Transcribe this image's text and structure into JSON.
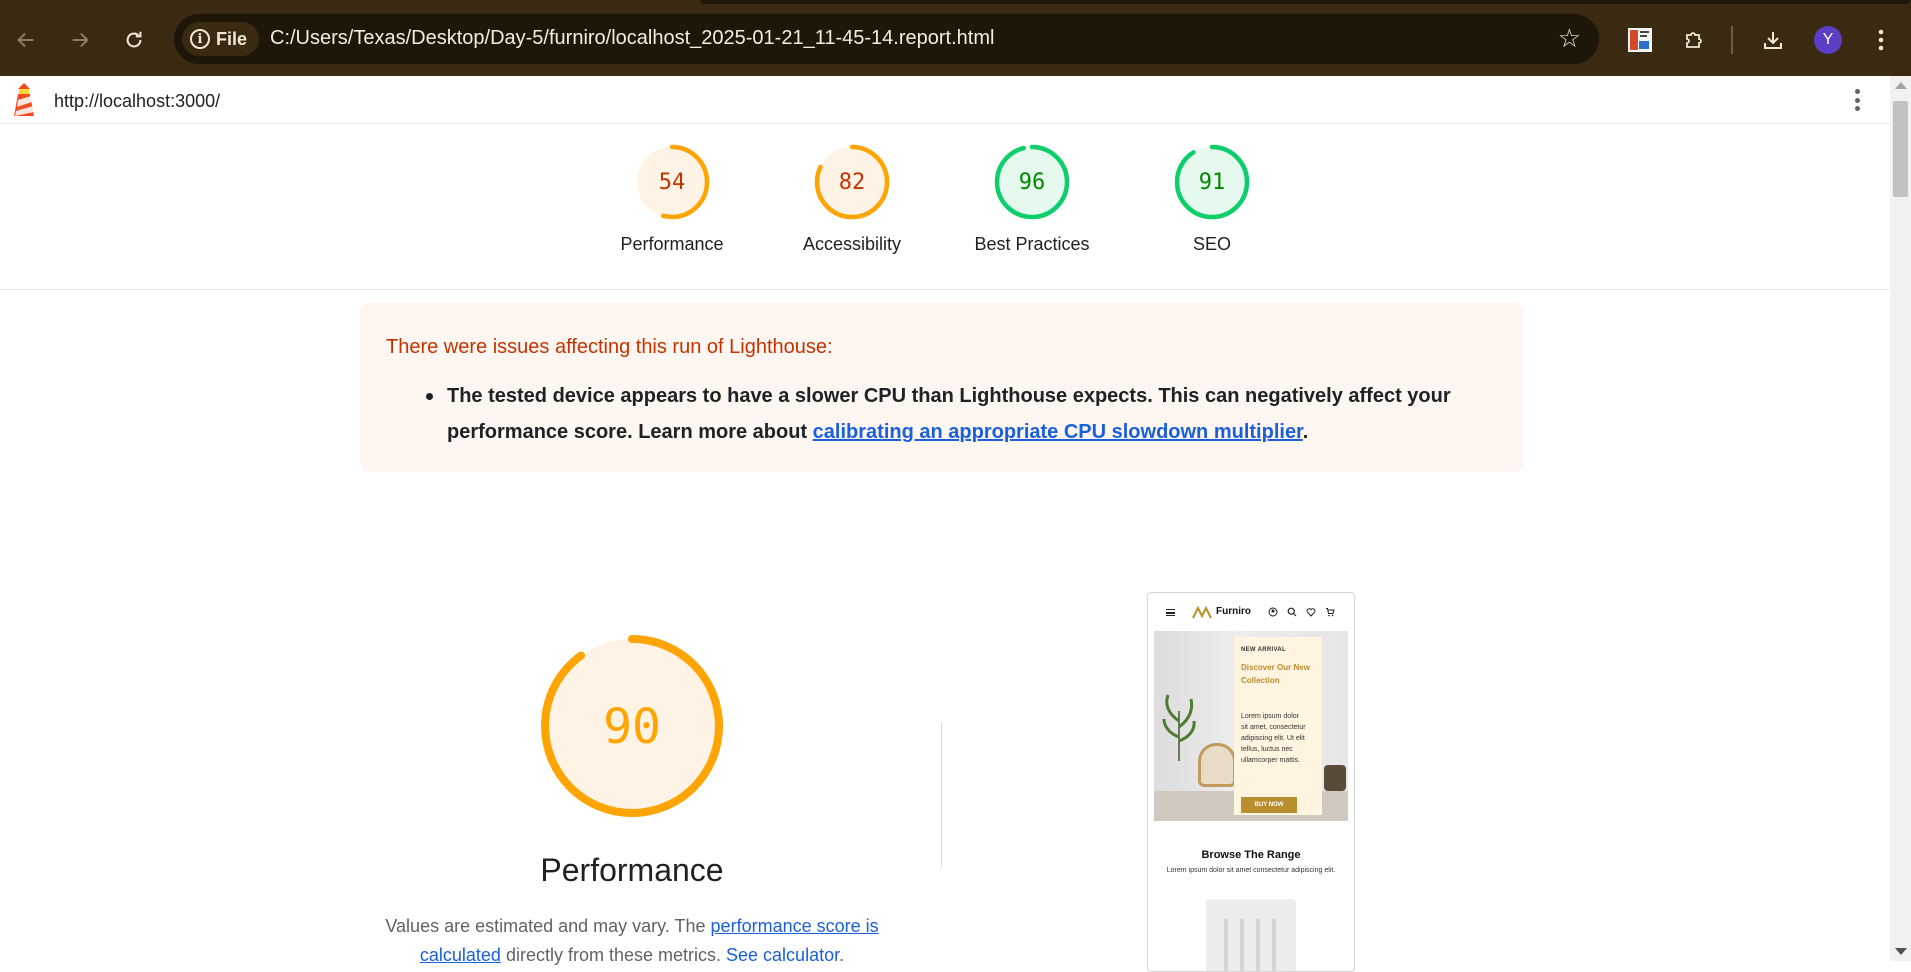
{
  "browser": {
    "url": "C:/Users/Texas/Desktop/Day-5/furniro/localhost_2025-01-21_11-45-14.report.html",
    "scheme_chip": "File",
    "profile_initial": "Y",
    "icons": {
      "back": "arrow-left-icon",
      "forward": "arrow-right-icon",
      "reload": "reload-icon",
      "info": "info-icon",
      "bookmark": "star-icon",
      "extension_app": "app-thumbnail-icon",
      "extensions": "puzzle-icon",
      "downloads": "download-icon",
      "menu": "kebab-menu-icon"
    }
  },
  "report": {
    "page_url": "http://localhost:3000/",
    "categories": [
      {
        "label": "Performance",
        "score": "54",
        "value": 54,
        "color": "#ffa400"
      },
      {
        "label": "Accessibility",
        "score": "82",
        "value": 82,
        "color": "#ffa400"
      },
      {
        "label": "Best Practices",
        "score": "96",
        "value": 96,
        "color": "#0cce6b"
      },
      {
        "label": "SEO",
        "score": "91",
        "value": 91,
        "color": "#0cce6b"
      }
    ],
    "warning": {
      "title": "There were issues affecting this run of Lighthouse:",
      "text_before": "The tested device appears to have a slower CPU than Lighthouse expects. This can negatively affect your performance score. Learn more about ",
      "link_text": "calibrating an appropriate CPU slowdown multiplier",
      "text_after": "."
    },
    "performance": {
      "score": "90",
      "value": 90,
      "title": "Performance",
      "desc_before": "Values are estimated and may vary. The ",
      "desc_link1": "performance score is calculated",
      "desc_middle": " directly from these metrics. ",
      "desc_link2": "See calculator",
      "desc_after": "."
    },
    "screenshot": {
      "brand": "Furniro",
      "badge": "NEW ARRIVAL",
      "headline": "Discover Our New Collection",
      "body": "Lorem ipsum dolor sit amet, consectetur adipiscing elit. Ut elit tellus, luctus nec ullamcorper mattis.",
      "button": "BUY NOW",
      "section_title": "Browse The Range",
      "section_sub": "Lorem ipsum dolor sit amet consectetur adipiscing elit."
    }
  },
  "colors": {
    "chrome_bg": "#3b2a12",
    "omnibox_bg": "#1f160a",
    "average": "#ffa400",
    "average_text": "#c33300",
    "pass": "#0cce6b",
    "pass_text": "#008800",
    "link": "#1a5fdc"
  }
}
